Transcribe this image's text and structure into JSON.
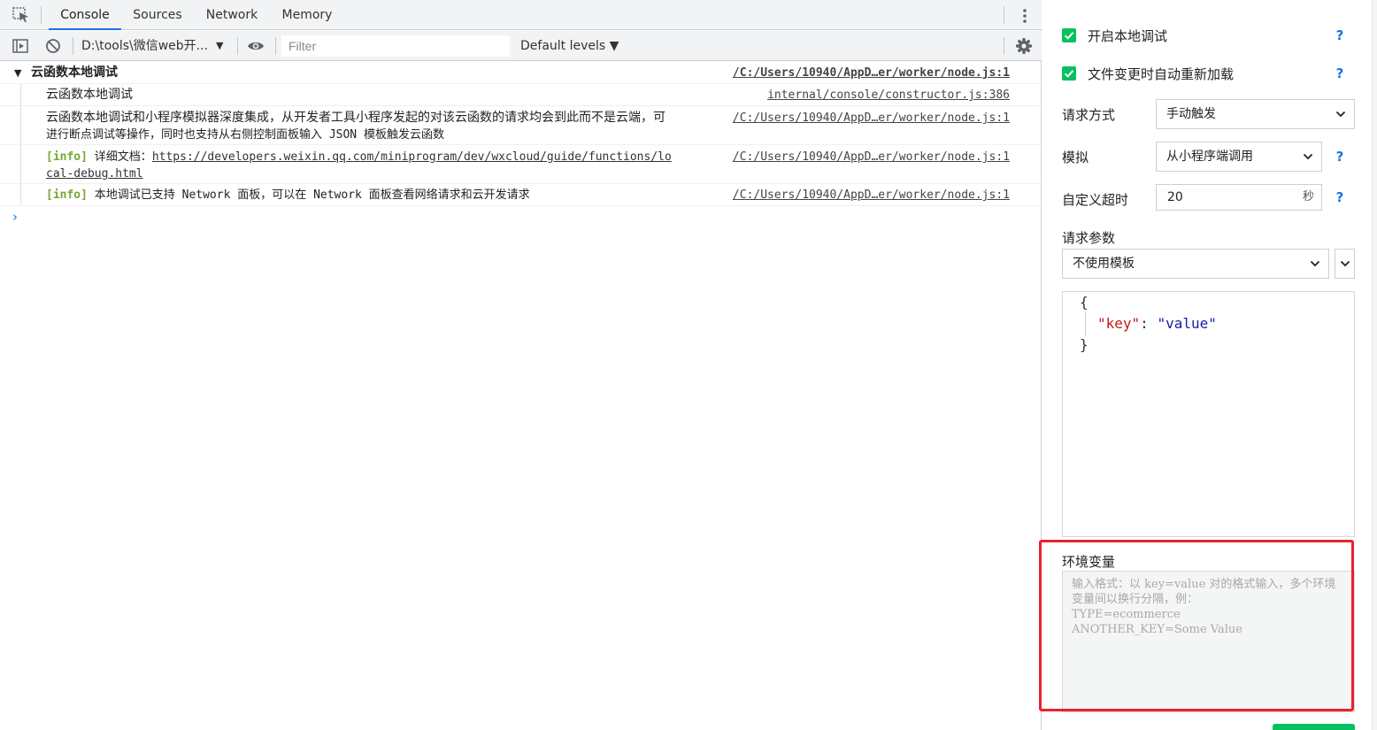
{
  "tabs": {
    "items": [
      "Console",
      "Sources",
      "Network",
      "Memory"
    ],
    "active": "Console"
  },
  "toolbar": {
    "context": "D:\\tools\\微信web开...",
    "context_caret": "▼",
    "filter_placeholder": "Filter",
    "levels": "Default levels ▼"
  },
  "console": {
    "group_title": "云函数本地调试",
    "rows": [
      {
        "source": "/C:/Users/10940/AppD…er/worker/node.js:1"
      },
      {
        "text": "云函数本地调试",
        "source": "internal/console/constructor.js:386"
      },
      {
        "line1": "云函数本地调试和小程序模拟器深度集成，从开发者工具小程序发起的对该云函数的请求均会到此而不是云端，可",
        "line2": "进行断点调试等操作，同时也支持从右侧控制面板输入 JSON 模板触发云函数",
        "source": "/C:/Users/10940/AppD…er/worker/node.js:1"
      },
      {
        "tag": "[info]",
        "label": "详细文档：",
        "link1": "https://developers.weixin.qq.com/miniprogram/dev/wxcloud/guide/functions/lo",
        "link2": "cal-debug.html",
        "source": "/C:/Users/10940/AppD…er/worker/node.js:1"
      },
      {
        "tag": "[info]",
        "text": "本地调试已支持 Network 面板，可以在 Network 面板查看网络请求和云开发请求",
        "source": "/C:/Users/10940/AppD…er/worker/node.js:1"
      }
    ],
    "prompt": "›"
  },
  "panel": {
    "enable_local_debug": "开启本地调试",
    "auto_reload": "文件变更时自动重新加载",
    "help": "?",
    "request_method_label": "请求方式",
    "request_method_value": "手动触发",
    "simulate_label": "模拟",
    "simulate_value": "从小程序端调用",
    "timeout_label": "自定义超时",
    "timeout_value": "20",
    "timeout_unit": "秒",
    "params_label": "请求参数",
    "template_value": "不使用模板",
    "json": {
      "open": "{",
      "key": "\"key\"",
      "colon": ": ",
      "value": "\"value\"",
      "close": "}"
    },
    "env_label": "环境变量",
    "env_placeholder": "输入格式：以 key=value 对的格式输入，多个环境变量间以换行分隔，例：\nTYPE=ecommerce\nANOTHER_KEY=Some Value"
  },
  "colors": {
    "accent_green": "#07c160",
    "link_blue": "#1a73e8",
    "info_green": "#74a832",
    "highlight_red": "#e8222e",
    "json_key": "#c41a16",
    "json_value": "#1a1aa6"
  }
}
